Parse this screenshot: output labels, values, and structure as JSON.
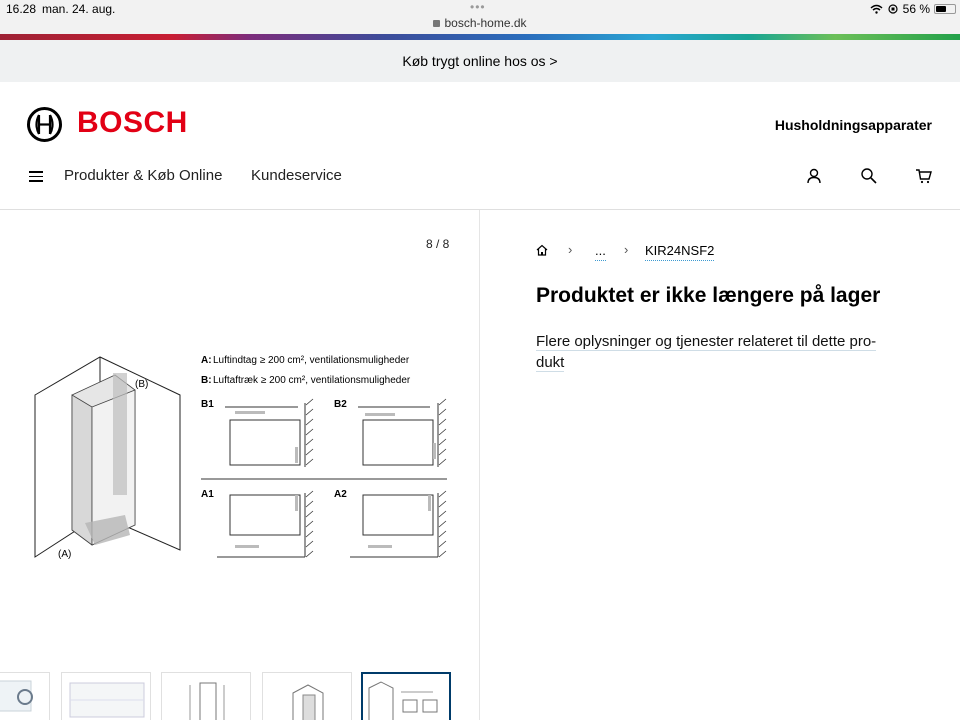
{
  "status_bar": {
    "time": "16.28",
    "date": "man. 24. aug.",
    "dots": "•••",
    "url": "bosch-home.dk",
    "battery": "56 %",
    "battery_level": 0.56
  },
  "promo": {
    "text": "Køb trygt online hos os >"
  },
  "header": {
    "logo_text": "BOSCH",
    "category": "Husholdningsapparater",
    "brand_color": "#e20015"
  },
  "nav": {
    "products": "Produkter & Køb Online",
    "service": "Kundeservice"
  },
  "gallery": {
    "counter": "8 / 8",
    "diagram": {
      "line_a": "Luftindtag ≥ 200 cm², ventilationsmuligheder",
      "line_a_prefix": "A:",
      "line_b": "Luftaftræk ≥ 200 cm², ventilationsmuligheder",
      "line_b_prefix": "B:",
      "label_b": "(B)",
      "label_a": "(A)",
      "b1": "B1",
      "b2": "B2",
      "a1": "A1",
      "a2": "A2"
    }
  },
  "breadcrumb": {
    "ellipsis": "...",
    "current": "KIR24NSF2"
  },
  "product": {
    "title": "Produktet er ikke længere på lager",
    "more_info_1": "Flere oplysninger og tjenester relateret til dette pro-",
    "more_info_2": "dukt"
  }
}
